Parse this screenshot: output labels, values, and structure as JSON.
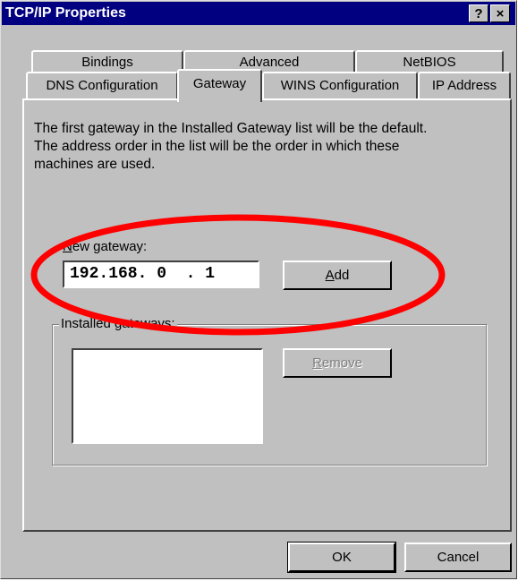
{
  "window": {
    "title": "TCP/IP Properties",
    "help_button": "?",
    "close_button": "×"
  },
  "tabs": {
    "row1": [
      "Bindings",
      "Advanced",
      "NetBIOS"
    ],
    "row2": [
      "DNS Configuration",
      "Gateway",
      "WINS Configuration",
      "IP Address"
    ],
    "active": "Gateway"
  },
  "gateway_panel": {
    "description_lines": [
      "The first gateway in the Installed Gateway list will be the default.",
      "The address order in the list will be the order in which these",
      "machines are used."
    ],
    "new_gateway_label_mnemonic": "N",
    "new_gateway_label_rest": "ew gateway:",
    "new_gateway_value": "192.168. 0  . 1",
    "add_button_mnemonic": "A",
    "add_button_rest": "dd",
    "installed_gateways_label": "Installed gateways:",
    "installed_gateways": [],
    "remove_button_mnemonic": "R",
    "remove_button_rest": "emove"
  },
  "footer": {
    "ok_label": "OK",
    "cancel_label": "Cancel"
  },
  "annotation": {
    "color": "#ff0000"
  },
  "colors": {
    "titlebar": "#000080",
    "face": "#c0c0c0"
  }
}
